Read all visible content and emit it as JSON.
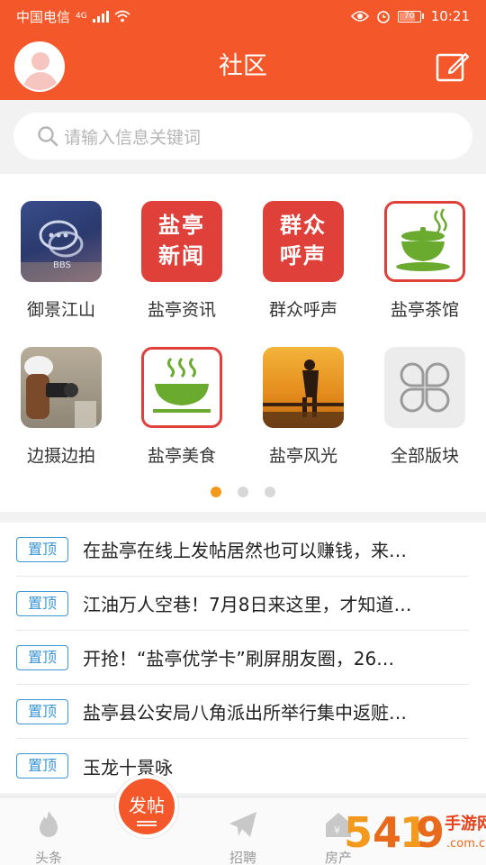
{
  "status_bar": {
    "carrier": "中国电信",
    "network": "4G",
    "battery": "70",
    "time": "10:21"
  },
  "header": {
    "title": "社区",
    "avatar_icon": "user-avatar-icon",
    "compose_icon": "compose-icon"
  },
  "search": {
    "placeholder": "请输入信息关键词",
    "icon": "search-icon"
  },
  "grid": {
    "items": [
      {
        "label": "御景江山",
        "icon": "bbs-chat-icon",
        "tile_text": "BBS"
      },
      {
        "label": "盐亭资讯",
        "icon": "news-icon",
        "tile_text_1": "盐亭",
        "tile_text_2": "新闻"
      },
      {
        "label": "群众呼声",
        "icon": "voice-icon",
        "tile_text_1": "群众",
        "tile_text_2": "呼声"
      },
      {
        "label": "盐亭茶馆",
        "icon": "tea-cup-icon"
      },
      {
        "label": "边摄边拍",
        "icon": "camera-photo-icon"
      },
      {
        "label": "盐亭美食",
        "icon": "food-bowl-icon"
      },
      {
        "label": "盐亭风光",
        "icon": "landscape-photo-icon"
      },
      {
        "label": "全部版块",
        "icon": "all-sections-icon"
      }
    ],
    "pages": 3,
    "current_page": 1
  },
  "feed": {
    "badge": "置顶",
    "items": [
      "在盐亭在线上发帖居然也可以赚钱，来…",
      "江油万人空巷！7月8日来这里，才知道…",
      "开抢！“盐亭优学卡”刷屏朋友圈，26…",
      "盐亭县公安局八角派出所举行集中返赃…",
      "玉龙十景咏"
    ]
  },
  "tabbar": {
    "tab1": "头条",
    "post": "发帖",
    "tab3": "招聘",
    "tab4": "房产",
    "watermark": "54119手游网",
    "watermark_url": ".com.cn"
  },
  "colors": {
    "brand": "#f4582a",
    "tile_red": "#e0403a",
    "badge_blue": "#3a97d4",
    "dot_active": "#f39a1e"
  }
}
